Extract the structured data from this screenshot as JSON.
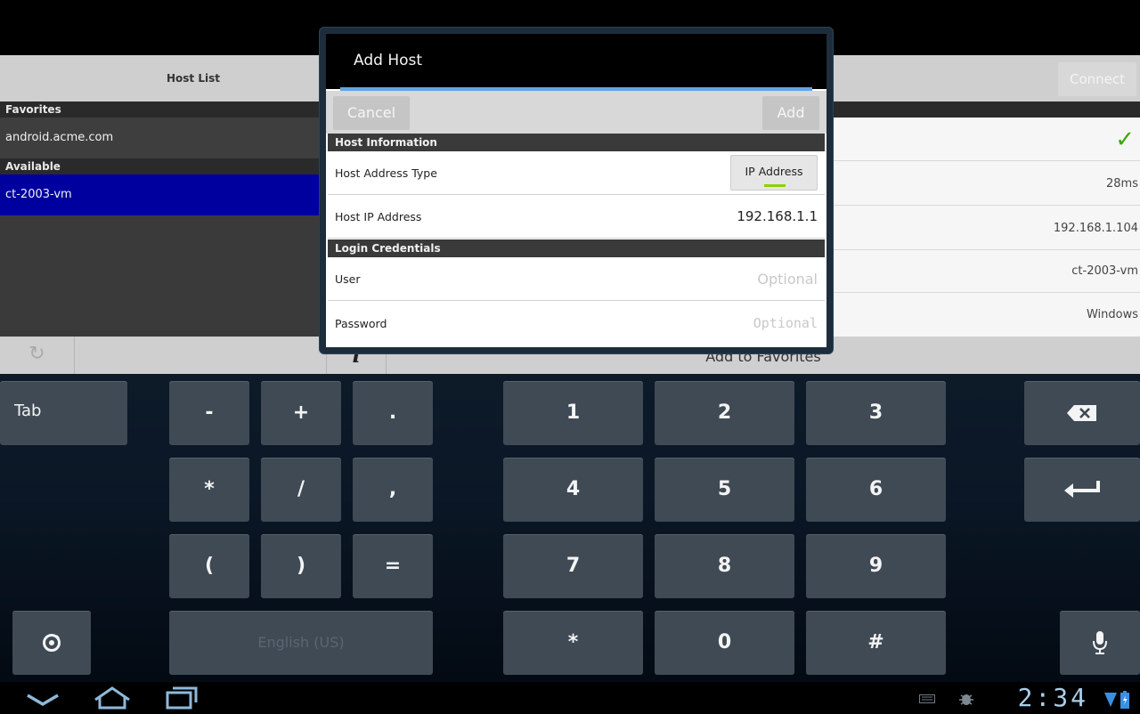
{
  "header": {
    "host_list_title": "Host List",
    "connect_label": "Connect"
  },
  "hosts": {
    "favorites_label": "Favorites",
    "favorites": [
      "android.acme.com"
    ],
    "available_label": "Available",
    "available": [
      "ct-2003-vm"
    ]
  },
  "details": {
    "rows": [
      "✓",
      "28ms",
      "192.168.1.104",
      "ct-2003-vm",
      "Windows"
    ]
  },
  "bottom_bar": {
    "refresh_icon": "refresh-icon",
    "info_label": "i",
    "add_to_favorites_label": "Add to Favorites"
  },
  "dialog": {
    "title": "Add Host",
    "cancel_label": "Cancel",
    "add_label": "Add",
    "host_info_section": "Host Information",
    "host_address_type_label": "Host Address Type",
    "host_address_type_value": "IP Address",
    "host_ip_label": "Host IP Address",
    "host_ip_value": "192.168.1.1",
    "login_section": "Login Credentials",
    "user_label": "User",
    "user_placeholder": "Optional",
    "password_label": "Password",
    "password_placeholder": "Optional"
  },
  "keyboard": {
    "tab": "Tab",
    "row1": [
      "-",
      "+",
      ".",
      "1",
      "2",
      "3"
    ],
    "row2": [
      "*",
      "/",
      ",",
      "4",
      "5",
      "6"
    ],
    "row3": [
      "(",
      ")",
      "=",
      "7",
      "8",
      "9"
    ],
    "row4": [
      "*",
      "0",
      "#"
    ],
    "space_label": "English (US)",
    "backspace_icon": "backspace-icon",
    "enter_icon": "enter-icon",
    "settings_icon": "settings-icon",
    "mic_icon": "microphone-icon"
  },
  "system_bar": {
    "clock": "2:34",
    "back_icon": "back-icon",
    "home_icon": "home-icon",
    "recents_icon": "recent-apps-icon",
    "keyboard_icon": "keyboard-icon",
    "debug_icon": "android-debug-icon",
    "wifi_icon": "wifi-icon",
    "battery_icon": "battery-icon"
  }
}
